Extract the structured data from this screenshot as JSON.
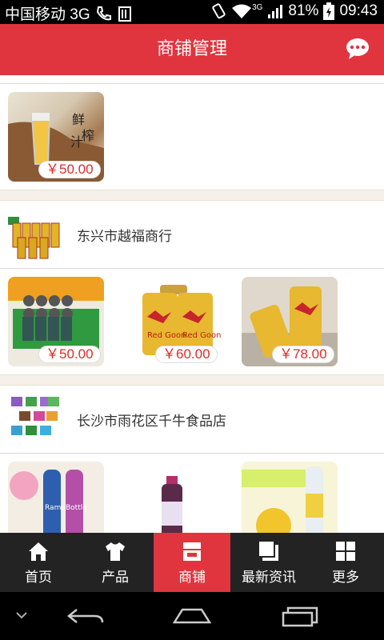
{
  "status": {
    "carrier": "中国移动 3G",
    "network": "3G",
    "battery": "81%",
    "time": "09:43"
  },
  "header": {
    "title": "商铺管理",
    "message_icon": "chat-bubble-icon"
  },
  "sections": [
    {
      "products": [
        {
          "price": "￥50.00",
          "image": "fresh-juice-image"
        }
      ]
    },
    {
      "shop_name": "东兴市越福商行",
      "products": [
        {
          "price": "￥50.00",
          "image": "energy-drink-case-image"
        },
        {
          "price": "￥60.00",
          "image": "red-bull-cans-image"
        },
        {
          "price": "￥78.00",
          "image": "red-bull-can-pair-image"
        }
      ]
    },
    {
      "shop_name": "长沙市雨花区千牛食品店",
      "products": [
        {
          "image": "ramune-bottles-image"
        },
        {
          "image": "juice-bottle-image"
        },
        {
          "image": "yuzu-drink-image"
        }
      ]
    }
  ],
  "bottom_nav": [
    {
      "label": "首页",
      "icon": "home-icon"
    },
    {
      "label": "产品",
      "icon": "tshirt-icon"
    },
    {
      "label": "商铺",
      "icon": "store-icon",
      "active": true
    },
    {
      "label": "最新资讯",
      "icon": "news-icon"
    },
    {
      "label": "更多",
      "icon": "grid-icon"
    }
  ],
  "colors": {
    "brand": "#e0353f",
    "price": "#e02a2a",
    "nav_bg": "#232323"
  }
}
